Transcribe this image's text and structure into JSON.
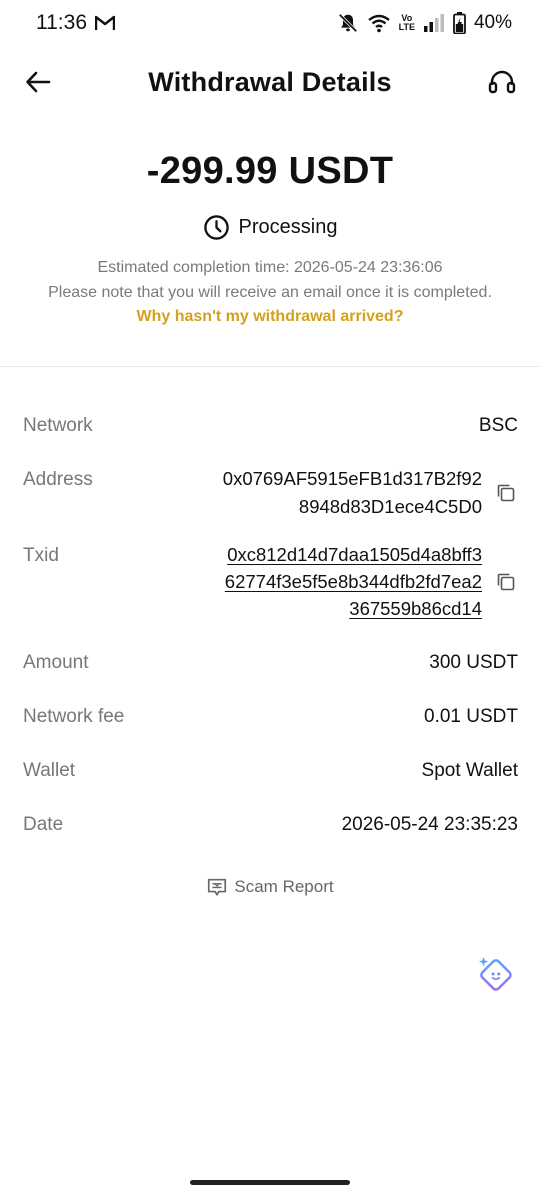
{
  "status_bar": {
    "time": "11:36",
    "mail_icon": "gmail-icon",
    "battery": "40%",
    "network_label_top": "Vo",
    "network_label_bottom": "LTE"
  },
  "header": {
    "title": "Withdrawal Details",
    "back_icon": "arrow-left-icon",
    "support_icon": "headset-icon"
  },
  "summary": {
    "amount": "-299.99 USDT",
    "status": "Processing",
    "eta": "Estimated completion time: 2026-05-24 23:36:06",
    "note": "Please note that you will receive an email once it is completed.",
    "help_link": "Why hasn't my withdrawal arrived?"
  },
  "details": {
    "network": {
      "label": "Network",
      "value": "BSC"
    },
    "address": {
      "label": "Address",
      "lines": [
        "0x0769AF5915eFB1d317B2f92",
        "8948d83D1ece4C5D0"
      ]
    },
    "txid": {
      "label": "Txid",
      "lines": [
        "0xc812d14d7daa1505d4a8bff3",
        "62774f3e5f5e8b344dfb2fd7ea2",
        "367559b86cd14"
      ]
    },
    "amount": {
      "label": "Amount",
      "value": "300 USDT"
    },
    "fee": {
      "label": "Network fee",
      "value": "0.01 USDT"
    },
    "wallet": {
      "label": "Wallet",
      "value": "Spot Wallet"
    },
    "date": {
      "label": "Date",
      "value": "2026-05-24 23:35:23"
    }
  },
  "footer": {
    "scam_report": "Scam Report"
  },
  "colors": {
    "accent_link": "#d4a01e",
    "muted_text": "#7a7a7a",
    "ai_gradient_start": "#5aa6ff",
    "ai_gradient_end": "#9a6bff"
  }
}
